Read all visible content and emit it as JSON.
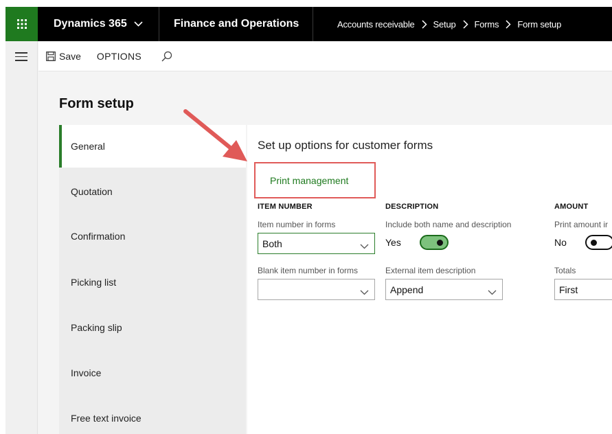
{
  "topbar": {
    "app_name": "Dynamics 365",
    "module": "Finance and Operations",
    "breadcrumbs": [
      "Accounts receivable",
      "Setup",
      "Forms",
      "Form setup"
    ]
  },
  "actions": {
    "save_label": "Save",
    "options_label": "OPTIONS"
  },
  "page": {
    "title": "Form setup",
    "tabs": [
      "General",
      "Quotation",
      "Confirmation",
      "Picking list",
      "Packing slip",
      "Invoice",
      "Free text invoice"
    ],
    "active_tab": "General"
  },
  "panel": {
    "title": "Set up options for customer forms",
    "print_management": "Print management",
    "item_number": {
      "header": "ITEM NUMBER",
      "item_number_label": "Item number in forms",
      "item_number_value": "Both",
      "blank_label": "Blank item number in forms",
      "blank_value": ""
    },
    "description": {
      "header": "DESCRIPTION",
      "include_label": "Include both name and description",
      "include_value": "Yes",
      "external_label": "External item description",
      "external_value": "Append"
    },
    "amount": {
      "header": "AMOUNT",
      "print_label": "Print amount ir",
      "print_value": "No",
      "totals_label": "Totals",
      "totals_value": "First"
    }
  },
  "colors": {
    "accent_green": "#2a7d2a",
    "annotation_red": "#e05a58",
    "topbar": "#000000"
  }
}
